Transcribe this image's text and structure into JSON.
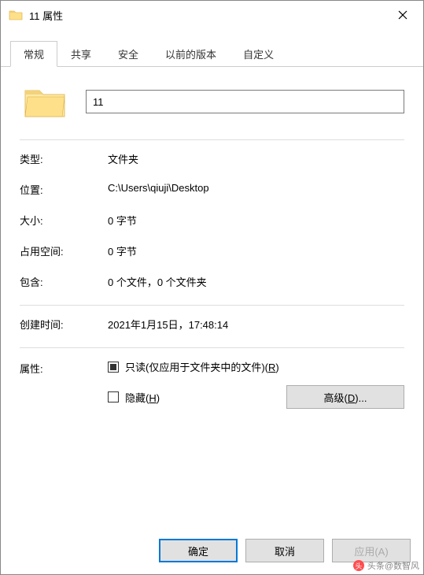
{
  "window": {
    "title": "11 属性"
  },
  "tabs": {
    "items": [
      {
        "label": "常规"
      },
      {
        "label": "共享"
      },
      {
        "label": "安全"
      },
      {
        "label": "以前的版本"
      },
      {
        "label": "自定义"
      }
    ]
  },
  "general": {
    "name_value": "11",
    "type_label": "类型:",
    "type_value": "文件夹",
    "location_label": "位置:",
    "location_value": "C:\\Users\\qiuji\\Desktop",
    "size_label": "大小:",
    "size_value": "0 字节",
    "size_on_disk_label": "占用空间:",
    "size_on_disk_value": "0 字节",
    "contains_label": "包含:",
    "contains_value": "0 个文件，0 个文件夹",
    "created_label": "创建时间:",
    "created_value": "2021年1月15日，17:48:14",
    "attributes_label": "属性:",
    "readonly_label_pre": "只读(仅应用于文件夹中的文件)(",
    "readonly_accel": "R",
    "readonly_label_post": ")",
    "hidden_label_pre": "隐藏(",
    "hidden_accel": "H",
    "hidden_label_post": ")",
    "advanced_label": "高级(D)..."
  },
  "footer": {
    "ok": "确定",
    "cancel": "取消",
    "apply": "应用(A)"
  },
  "watermark": {
    "text": "头条@数智风"
  }
}
